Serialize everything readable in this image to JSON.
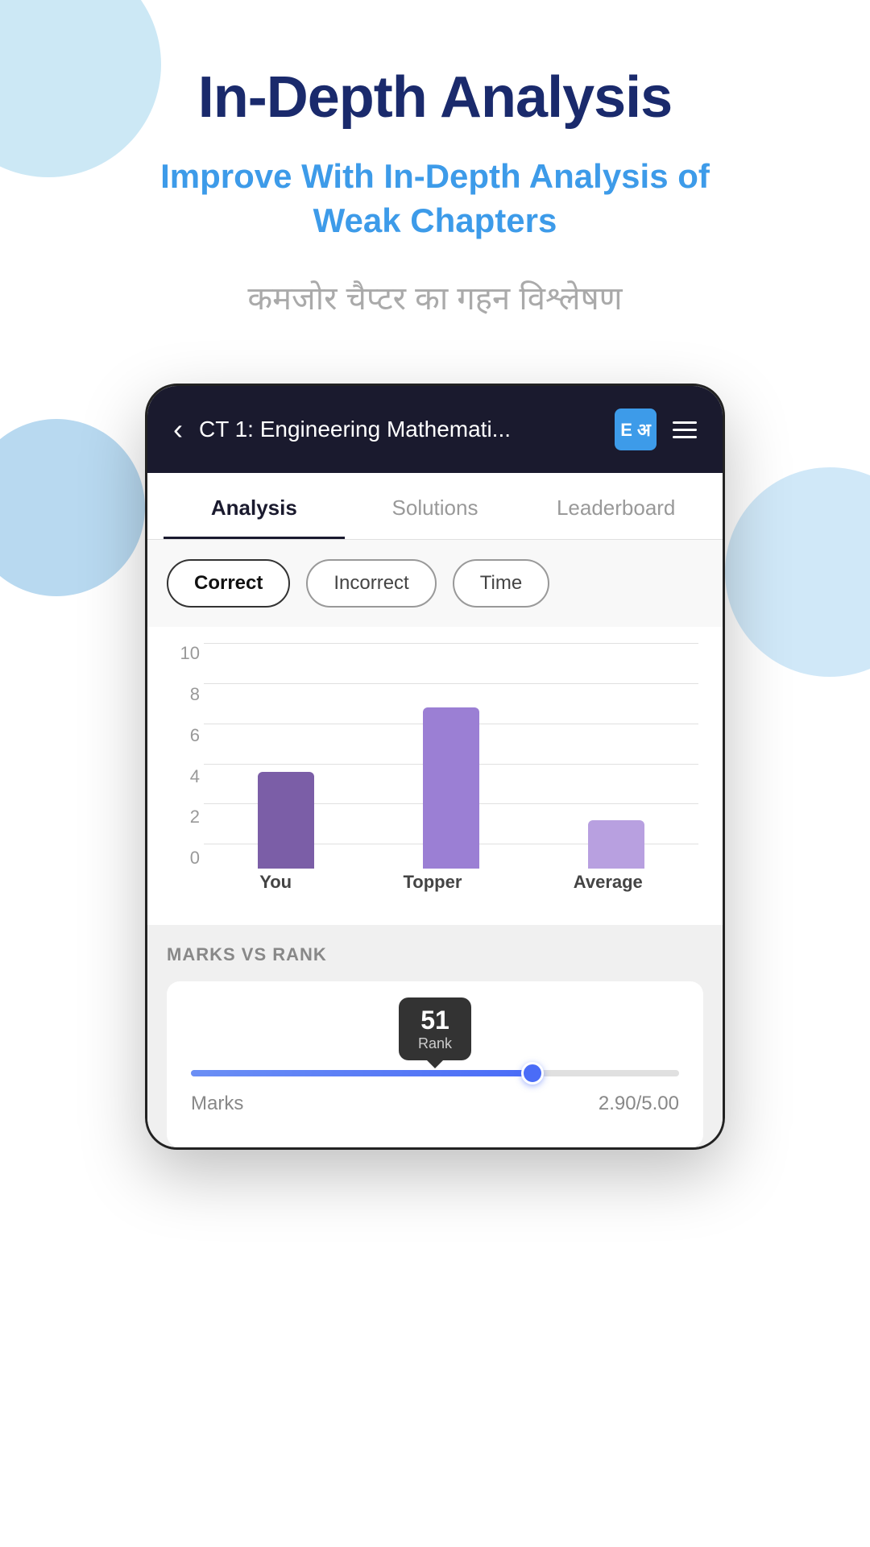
{
  "page": {
    "main_title": "In-Depth Analysis",
    "subtitle": "Improve With In-Depth Analysis of Weak Chapters",
    "hindi_text": "कमजोर चैप्टर का गहन विश्लेषण"
  },
  "app_header": {
    "back_icon": "‹",
    "title": "CT 1: Engineering Mathemati...",
    "brand_icon": "E अ",
    "menu_icon": "≡"
  },
  "tabs": [
    {
      "label": "Analysis",
      "active": true
    },
    {
      "label": "Solutions",
      "active": false
    },
    {
      "label": "Leaderboard",
      "active": false
    }
  ],
  "filter_buttons": [
    {
      "label": "Correct",
      "active": true
    },
    {
      "label": "Incorrect",
      "active": false
    },
    {
      "label": "Time",
      "active": false
    }
  ],
  "chart": {
    "y_labels": [
      "0",
      "2",
      "4",
      "6",
      "8",
      "10"
    ],
    "bars": [
      {
        "label": "You",
        "height_ratio": 0.38,
        "color": "#7b5ea7"
      },
      {
        "label": "Topper",
        "height_ratio": 0.63,
        "color": "#9b7fd4"
      },
      {
        "label": "Average",
        "height_ratio": 0.2,
        "color": "#b8a0e0"
      }
    ]
  },
  "marks_rank": {
    "section_title": "MARKS VS RANK",
    "rank_label": "Rank",
    "rank_value": "51",
    "marks_label": "Marks",
    "marks_value": "2.90/5.00",
    "slider_fill_percent": 70
  }
}
